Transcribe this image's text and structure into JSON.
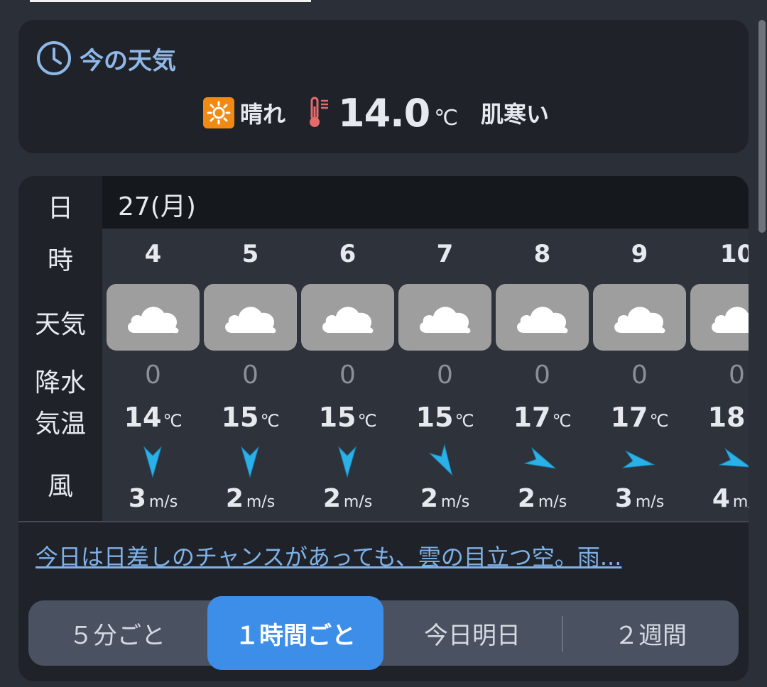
{
  "current": {
    "title": "今の天気",
    "condition": "晴れ",
    "temperature": "14.0",
    "unit": "℃",
    "feel": "肌寒い",
    "icons": {
      "title": "clock-icon",
      "condition": "sun-icon",
      "temperature": "thermometer-icon"
    }
  },
  "forecast": {
    "labels": {
      "day": "日",
      "hour": "時",
      "weather": "天気",
      "precip": "降水",
      "temp": "気温",
      "wind": "風"
    },
    "date": "27(月)",
    "temp_unit": "℃",
    "wind_unit": "m/s",
    "hours": [
      {
        "hour": "4",
        "icon": "cloud-icon",
        "precip": "0",
        "temp": "14",
        "wind_speed": "3",
        "wind_dir_deg": 0
      },
      {
        "hour": "5",
        "icon": "cloud-icon",
        "precip": "0",
        "temp": "15",
        "wind_speed": "2",
        "wind_dir_deg": 0
      },
      {
        "hour": "6",
        "icon": "cloud-icon",
        "precip": "0",
        "temp": "15",
        "wind_speed": "2",
        "wind_dir_deg": 0
      },
      {
        "hour": "7",
        "icon": "cloud-icon",
        "precip": "0",
        "temp": "15",
        "wind_speed": "2",
        "wind_dir_deg": -30
      },
      {
        "hour": "8",
        "icon": "cloud-icon",
        "precip": "0",
        "temp": "17",
        "wind_speed": "2",
        "wind_dir_deg": -65
      },
      {
        "hour": "9",
        "icon": "cloud-icon",
        "precip": "0",
        "temp": "17",
        "wind_speed": "3",
        "wind_dir_deg": -80
      },
      {
        "hour": "10",
        "icon": "cloud-icon",
        "precip": "0",
        "temp": "18",
        "wind_speed": "4",
        "wind_dir_deg": -70
      }
    ],
    "summary": "今日は日差しのチャンスがあっても、雲の目立つ空。雨..."
  },
  "tabs": [
    {
      "label": "５分ごと",
      "active": false
    },
    {
      "label": "１時間ごと",
      "active": true
    },
    {
      "label": "今日明日",
      "active": false
    },
    {
      "label": "２週間",
      "active": false
    }
  ],
  "colors": {
    "accent": "#3d8ee8",
    "link": "#7fb1e8",
    "sun": "#f08a12",
    "arrow": "#2bb0e8",
    "tile": "#9e9e9e"
  }
}
